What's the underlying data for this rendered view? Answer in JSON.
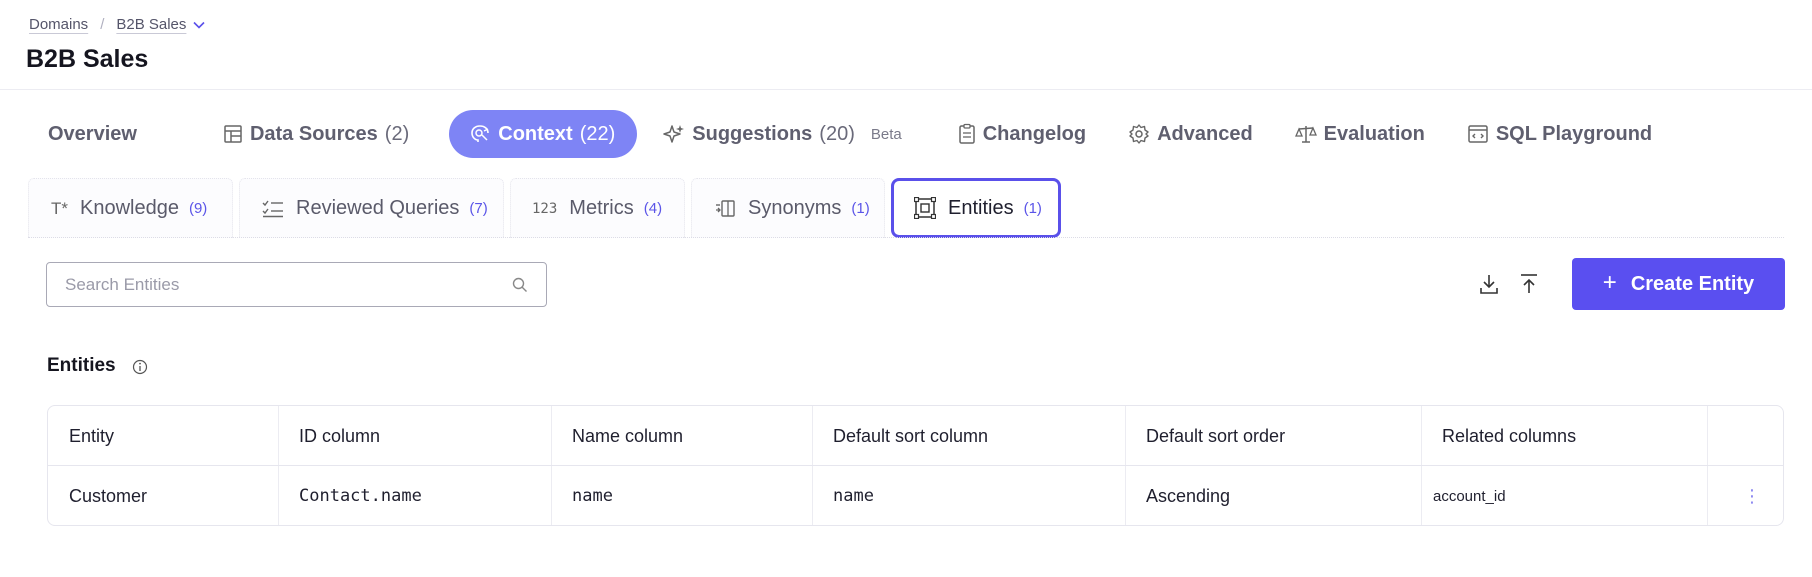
{
  "breadcrumb": {
    "root": "Domains",
    "current": "B2B Sales"
  },
  "page": {
    "title": "B2B Sales"
  },
  "main_tabs": [
    {
      "label": "Overview",
      "count": ""
    },
    {
      "label": "Data Sources",
      "count": "(2)"
    },
    {
      "label": "Context",
      "count": "(22)"
    },
    {
      "label": "Suggestions",
      "count": "(20)",
      "badge": "Beta"
    },
    {
      "label": "Changelog",
      "count": ""
    },
    {
      "label": "Advanced",
      "count": ""
    },
    {
      "label": "Evaluation",
      "count": ""
    },
    {
      "label": "SQL Playground",
      "count": ""
    }
  ],
  "sub_tabs": [
    {
      "label": "Knowledge",
      "count": "(9)",
      "icon_text": "T*"
    },
    {
      "label": "Reviewed Queries",
      "count": "(7)"
    },
    {
      "label": "Metrics",
      "count": "(4)",
      "icon_text": "123"
    },
    {
      "label": "Synonyms",
      "count": "(1)"
    },
    {
      "label": "Entities",
      "count": "(1)"
    }
  ],
  "search": {
    "placeholder": "Search Entities",
    "value": ""
  },
  "actions": {
    "create_label": "Create Entity"
  },
  "section": {
    "title": "Entities"
  },
  "table": {
    "headers": [
      "Entity",
      "ID column",
      "Name column",
      "Default sort column",
      "Default sort order",
      "Related columns"
    ],
    "rows": [
      [
        "Customer",
        "Contact.name",
        "name",
        "name",
        "Ascending",
        "account_id"
      ]
    ]
  },
  "colors": {
    "accent": "#5a4ff0",
    "active_tab": "#7e84f5",
    "count": "#5b55e8"
  },
  "icons": [
    "chevron-down-icon",
    "data-sources-icon",
    "context-icon",
    "sparkle-icon",
    "clipboard-icon",
    "gear-icon",
    "scale-icon",
    "sql-playground-icon",
    "checklist-icon",
    "synonyms-icon",
    "entities-icon",
    "search-icon",
    "download-icon",
    "upload-icon",
    "info-icon",
    "kebab-icon"
  ]
}
